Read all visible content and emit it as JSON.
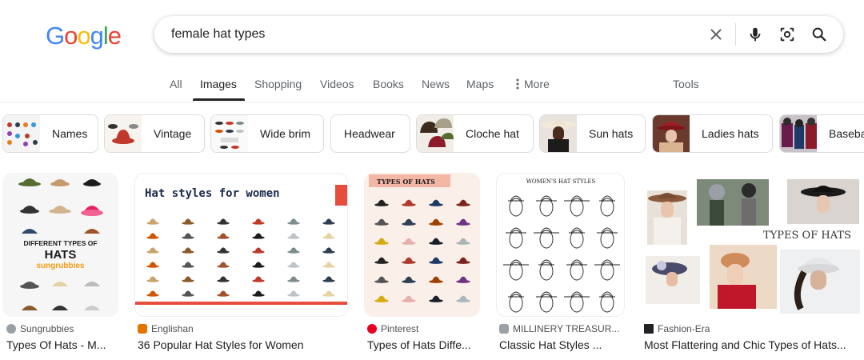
{
  "logo": {
    "letters": [
      "G",
      "o",
      "o",
      "g",
      "l",
      "e"
    ],
    "colors": [
      "#4285F4",
      "#EA4335",
      "#FBBC05",
      "#4285F4",
      "#34A853",
      "#EA4335"
    ]
  },
  "search": {
    "query": "female hat types",
    "icons": [
      "clear-icon",
      "mic-icon",
      "lens-icon",
      "search-icon"
    ]
  },
  "tabs": [
    {
      "label": "All",
      "active": false
    },
    {
      "label": "Images",
      "active": true
    },
    {
      "label": "Shopping",
      "active": false
    },
    {
      "label": "Videos",
      "active": false
    },
    {
      "label": "Books",
      "active": false
    },
    {
      "label": "News",
      "active": false
    },
    {
      "label": "Maps",
      "active": false
    },
    {
      "label": "More",
      "active": false
    }
  ],
  "tools_label": "Tools",
  "chips": [
    {
      "label": "Names"
    },
    {
      "label": "Vintage"
    },
    {
      "label": "Wide brim"
    },
    {
      "label": "Headwear"
    },
    {
      "label": "Cloche hat"
    },
    {
      "label": "Sun hats"
    },
    {
      "label": "Ladies hats"
    },
    {
      "label": "Baseba"
    }
  ],
  "results": [
    {
      "source": "Sungrubbies",
      "title": "Types Of Hats - M...",
      "favicon_color": "#9aa0a6",
      "image_heading": "DIFFERENT TYPES OF",
      "image_heading2": "HATS",
      "image_brand": "sungrubbies"
    },
    {
      "source": "Englishan",
      "title": "36 Popular Hat Styles for Women",
      "favicon_color": "#e37400",
      "image_heading": "Hat styles for women"
    },
    {
      "source": "Pinterest",
      "title": "Types of Hats Diffe...",
      "favicon_color": "#e60023",
      "image_heading": "TYPES OF HATS"
    },
    {
      "source": "MILLINERY TREASUR...",
      "title": "Classic Hat Styles ...",
      "favicon_color": "#9aa0a6",
      "image_heading": "WOMEN'S HAT STYLES"
    },
    {
      "source": "Fashion-Era",
      "title": "Most Flattering and Chic Types of Hats...",
      "favicon_color": "#202124",
      "image_heading": "TYPES OF HATS"
    }
  ]
}
